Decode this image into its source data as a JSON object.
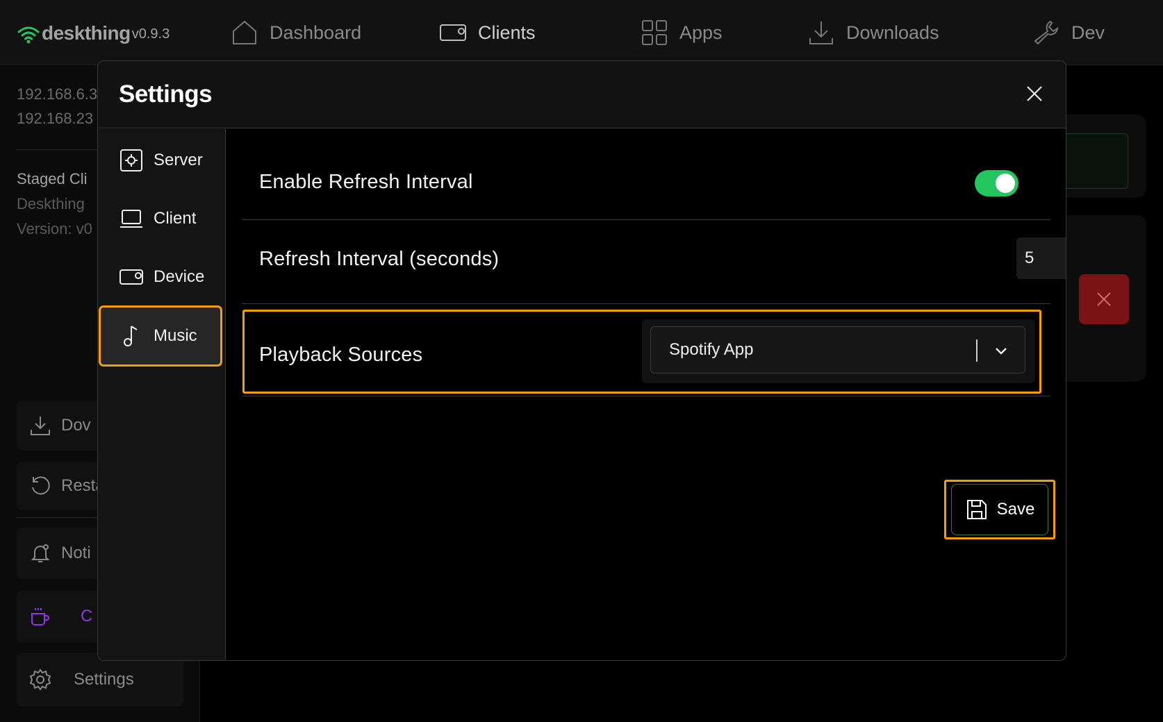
{
  "app": {
    "name": "deskthing",
    "version": "v0.9.3"
  },
  "nav": [
    {
      "label": "Dashboard",
      "icon": "home-icon"
    },
    {
      "label": "Clients",
      "icon": "device-icon"
    },
    {
      "label": "Apps",
      "icon": "grid-icon"
    },
    {
      "label": "Downloads",
      "icon": "download-icon"
    },
    {
      "label": "Dev",
      "icon": "wrench-icon"
    }
  ],
  "background": {
    "ip1": "192.168.6.3",
    "ip2": "192.168.23",
    "staged": "Staged Cli",
    "staged_name": "Deskthing",
    "staged_version": "Version: v0",
    "cards": [
      "Dov",
      "Resta",
      "Noti",
      "C",
      "Settings"
    ]
  },
  "modal": {
    "title": "Settings",
    "nav": [
      "Server",
      "Client",
      "Device",
      "Music"
    ],
    "rows": {
      "refresh_enable_label": "Enable Refresh Interval",
      "refresh_interval_label": "Refresh Interval (seconds)",
      "refresh_interval_value": "5",
      "playback_label": "Playback Sources",
      "playback_value": "Spotify App"
    },
    "save_label": "Save"
  },
  "colors": {
    "accent_green": "#22c55e",
    "highlight_orange": "#f59e0b",
    "danger_red": "#7a1414"
  }
}
